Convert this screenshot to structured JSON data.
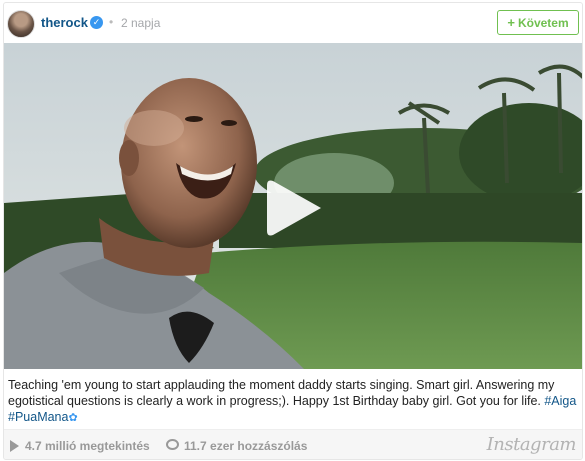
{
  "header": {
    "username": "therock",
    "time_ago": "2 napja",
    "follow_label": "Követem",
    "follow_plus": "+"
  },
  "post": {
    "caption_text": "Teaching 'em young to start applauding the moment daddy starts singing. Smart girl. Answering my egotistical questions is clearly a work in progress;). Happy 1st Birthday baby girl. Got you for life. ",
    "hashtags": [
      "#Aiga",
      "#PuaMana"
    ],
    "flower_icon": "✿"
  },
  "stats": {
    "views": "4.7 millió megtekintés",
    "comments": "11.7 ezer hozzászólás"
  },
  "brand": "Instagram",
  "colors": {
    "link": "#125688",
    "follow": "#70c050",
    "verified": "#3897f0"
  },
  "icons": [
    "verified-badge-icon",
    "play-icon",
    "views-icon",
    "comments-icon"
  ]
}
